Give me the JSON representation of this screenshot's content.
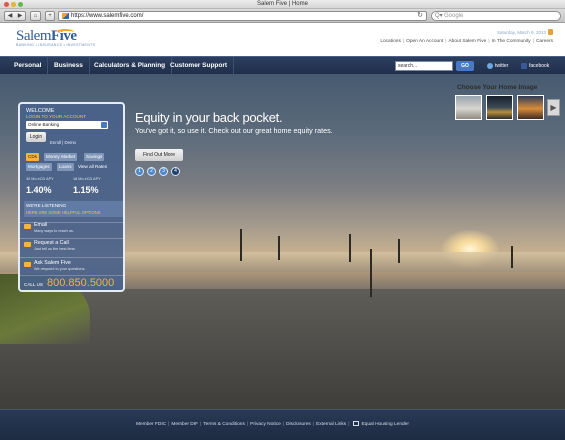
{
  "window": {
    "title": "Salem Five | Home"
  },
  "browser": {
    "url": "https://www.salemfive.com/",
    "search_placeholder": "Google",
    "back_glyph": "◀",
    "forward_glyph": "▶",
    "home_glyph": "⌂",
    "add_glyph": "+",
    "reload_glyph": "↻",
    "search_glyph": "Q▾"
  },
  "header": {
    "logo_text_salem": "Salem",
    "logo_text_five": "Five",
    "logo_tagline": "BANKING • INSURANCE • INVESTMENTS",
    "date": "Saturday, March 9, 2013",
    "util_links": [
      "Locations",
      "Open An Account",
      "About Salem Five",
      "In The Community",
      "Careers"
    ]
  },
  "nav": {
    "items": [
      "Personal",
      "Business",
      "Calculators & Planning",
      "Customer Support"
    ],
    "search_value": "search...",
    "go_label": "GO",
    "twitter": "twitter",
    "facebook": "facebook"
  },
  "hero": {
    "title": "Equity in your back pocket.",
    "subtitle": "You've got it, so use it. Check out our great home equity rates.",
    "cta": "Find Out More",
    "pager": [
      "1",
      "2",
      "3",
      "4"
    ],
    "pager_active": 4,
    "choose_title": "Choose Your Home Image",
    "next_glyph": "▶"
  },
  "panel": {
    "welcome": "WELCOME",
    "login_to": "LOGIN TO YOUR ACCOUNT",
    "select_value": "Online Banking",
    "login_btn": "Login",
    "enroll_demo": "Enroll | Demo",
    "tabs": [
      "CDs",
      "Money Market",
      "Savings",
      "Mortgages",
      "Loans",
      "View all Rates"
    ],
    "active_tab": "CDs",
    "rates": [
      {
        "label": "30 Mo eCD APY",
        "value": "1.40%"
      },
      {
        "label": "18 Mo eCD APY",
        "value": "1.15%"
      }
    ],
    "listening_1": "WE'RE LISTENING",
    "listening_2": "HERE ARE SOME HELPFUL OPTIONS",
    "options": [
      {
        "title": "Email",
        "sub": "Many ways to reach us."
      },
      {
        "title": "Request a Call",
        "sub": "Just tell us the best time."
      },
      {
        "title": "Ask Salem Five",
        "sub": "We respond to your questions."
      }
    ],
    "call_label": "CALL US",
    "call_number": "800.850.5000"
  },
  "footer": {
    "links": [
      "Member FDIC",
      "Member DIF",
      "Terms & Conditions",
      "Privacy Notice",
      "Disclosures",
      "External Links"
    ],
    "equal_housing": "Equal Housing Lender"
  },
  "colors": {
    "brand_blue": "#2f5d9a",
    "nav_dark": "#1f2f4b",
    "accent_orange": "#f3b63b",
    "go_blue": "#4a79c3"
  }
}
